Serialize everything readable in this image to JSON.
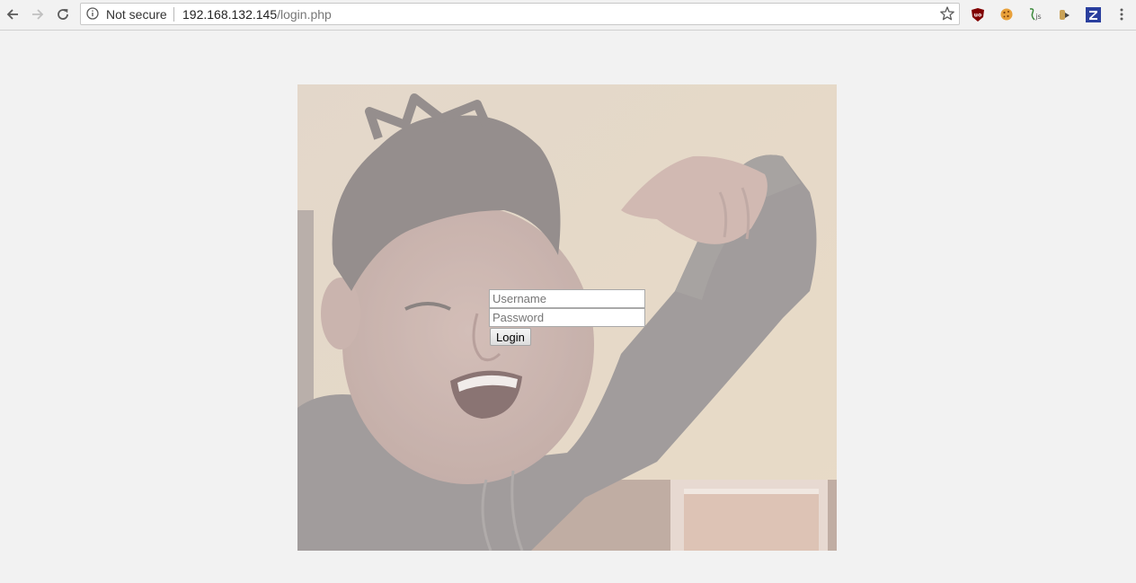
{
  "browser": {
    "security_label": "Not secure",
    "url_host": "192.168.132.145",
    "url_path": "/login.php",
    "icons": [
      "back-arrow-icon",
      "forward-arrow-icon",
      "reload-icon",
      "info-icon",
      "bookmark-star-icon",
      "ublock-icon",
      "cookie-icon",
      "javascript-toggle-icon",
      "privacy-extension-icon",
      "zotero-icon",
      "menu-dots-icon"
    ]
  },
  "login": {
    "username_placeholder": "Username",
    "password_placeholder": "Password",
    "login_button_label": "Login"
  },
  "colors": {
    "page_background": "#f2f2f2",
    "ublock_red": "#800000",
    "zotero_blue": "#2a3f9e"
  }
}
